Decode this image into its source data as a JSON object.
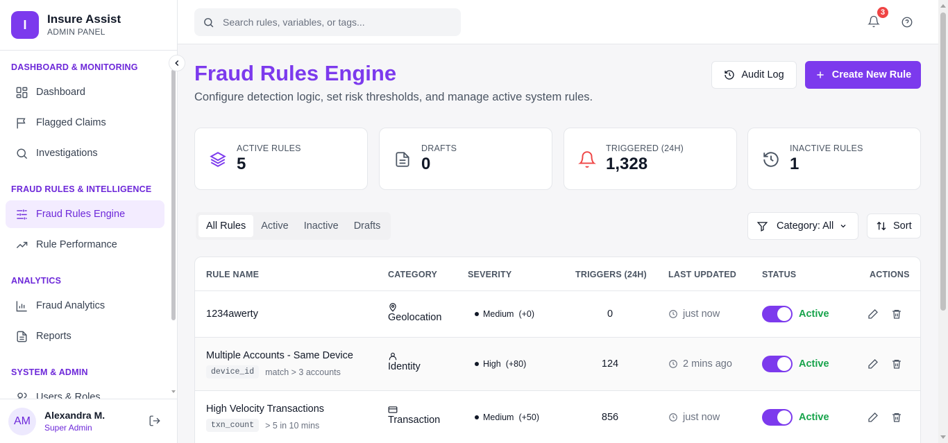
{
  "brand": {
    "initial": "I",
    "title": "Insure Assist",
    "subtitle": "ADMIN PANEL"
  },
  "sidebar": {
    "sections": [
      {
        "title": "DASHBOARD & MONITORING",
        "items": [
          {
            "label": "Dashboard",
            "icon": "grid-icon"
          },
          {
            "label": "Flagged Claims",
            "icon": "flag-icon"
          },
          {
            "label": "Investigations",
            "icon": "search-icon"
          }
        ]
      },
      {
        "title": "FRAUD RULES & INTELLIGENCE",
        "items": [
          {
            "label": "Fraud Rules Engine",
            "icon": "sliders-icon",
            "active": true
          },
          {
            "label": "Rule Performance",
            "icon": "trending-up-icon"
          }
        ]
      },
      {
        "title": "ANALYTICS",
        "items": [
          {
            "label": "Fraud Analytics",
            "icon": "bar-chart-icon"
          },
          {
            "label": "Reports",
            "icon": "file-icon"
          }
        ]
      },
      {
        "title": "SYSTEM & ADMIN",
        "items": [
          {
            "label": "Users & Roles",
            "icon": "users-icon"
          }
        ]
      }
    ]
  },
  "user": {
    "initials": "AM",
    "name": "Alexandra M.",
    "role": "Super Admin"
  },
  "search": {
    "placeholder": "Search rules, variables, or tags..."
  },
  "notifications": {
    "count": "3"
  },
  "page": {
    "title": "Fraud Rules Engine",
    "subtitle": "Configure detection logic, set risk thresholds, and manage active system rules.",
    "audit_label": "Audit Log",
    "create_label": "Create New Rule"
  },
  "stats": [
    {
      "label": "ACTIVE RULES",
      "value": "5",
      "icon": "layers-icon",
      "color": "#7c3aed"
    },
    {
      "label": "DRAFTS",
      "value": "0",
      "icon": "document-icon",
      "color": "#4b5563"
    },
    {
      "label": "TRIGGERED (24H)",
      "value": "1,328",
      "icon": "bell-icon",
      "color": "#ef4444"
    },
    {
      "label": "INACTIVE RULES",
      "value": "1",
      "icon": "history-icon",
      "color": "#4b5563"
    }
  ],
  "tabs": [
    "All Rules",
    "Active",
    "Inactive",
    "Drafts"
  ],
  "filter": {
    "label": "Category: All"
  },
  "sort": {
    "label": "Sort"
  },
  "table": {
    "headers": [
      "RULE NAME",
      "CATEGORY",
      "SEVERITY",
      "TRIGGERS (24H)",
      "LAST UPDATED",
      "STATUS",
      "ACTIONS"
    ],
    "rows": [
      {
        "name": "1234awerty",
        "tag": "",
        "condition": "",
        "category": "Geolocation",
        "category_icon": "map-pin-icon",
        "severity": "Medium",
        "score": "(+0)",
        "triggers": "0",
        "updated": "just now",
        "status": "Active"
      },
      {
        "name": "Multiple Accounts - Same Device",
        "tag": "device_id",
        "condition": "match > 3 accounts",
        "category": "Identity",
        "category_icon": "user-icon",
        "severity": "High",
        "score": "(+80)",
        "triggers": "124",
        "updated": "2 mins ago",
        "status": "Active"
      },
      {
        "name": "High Velocity Transactions",
        "tag": "txn_count",
        "condition": "> 5 in 10 mins",
        "category": "Transaction",
        "category_icon": "card-icon",
        "severity": "Medium",
        "score": "(+50)",
        "triggers": "856",
        "updated": "just now",
        "status": "Active"
      }
    ]
  }
}
